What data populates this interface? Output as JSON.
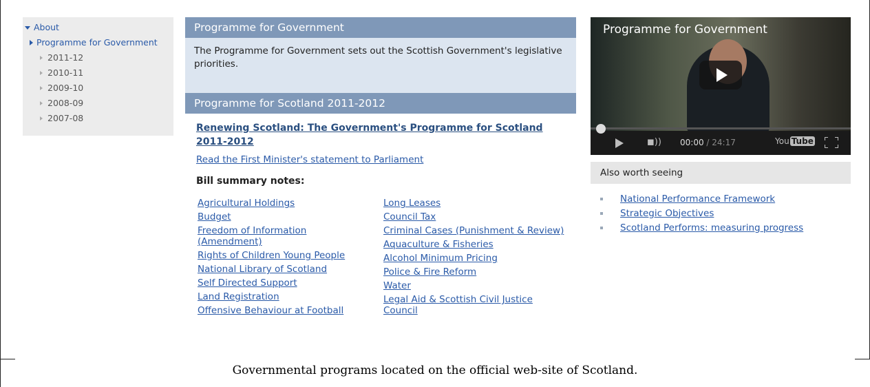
{
  "sidebar": {
    "about": "About",
    "programme": "Programme for Government",
    "years": [
      "2011-12",
      "2010-11",
      "2009-10",
      "2008-09",
      "2007-08"
    ]
  },
  "box1": {
    "title": "Programme for Government",
    "text": "The Programme for Government sets out the Scottish Government's legislative priorities."
  },
  "box2": {
    "title": "Programme for Scotland 2011-2012",
    "main_link": "Renewing Scotland: The Government's Programme for Scotland 2011-2012",
    "statement_link": "Read the First Minister's statement to Parliament",
    "bill_heading": "Bill summary notes:",
    "bills_left": [
      "Agricultural Holdings",
      "Budget",
      "Freedom of Information (Amendment)",
      "Rights of Children Young People",
      "National Library of Scotland",
      "Self Directed Support",
      "Land Registration",
      "Offensive Behaviour at Football"
    ],
    "bills_right": [
      "Long Leases",
      "Council Tax",
      "Criminal Cases (Punishment & Review)",
      "Aquaculture & Fisheries",
      "Alcohol Minimum Pricing",
      "Police & Fire Reform",
      "Water",
      "Legal Aid & Scottish Civil Justice Council"
    ]
  },
  "video": {
    "title": "Programme for Government",
    "current_time": "00:00",
    "duration": "/ 24:17",
    "logo_you": "You",
    "logo_tube": "Tube"
  },
  "also": {
    "heading": "Also worth seeing",
    "links": [
      "National Performance Framework",
      "Strategic Objectives",
      "Scotland Performs: measuring progress"
    ]
  },
  "caption": "Governmental programs located on the official web-site of Scotland."
}
